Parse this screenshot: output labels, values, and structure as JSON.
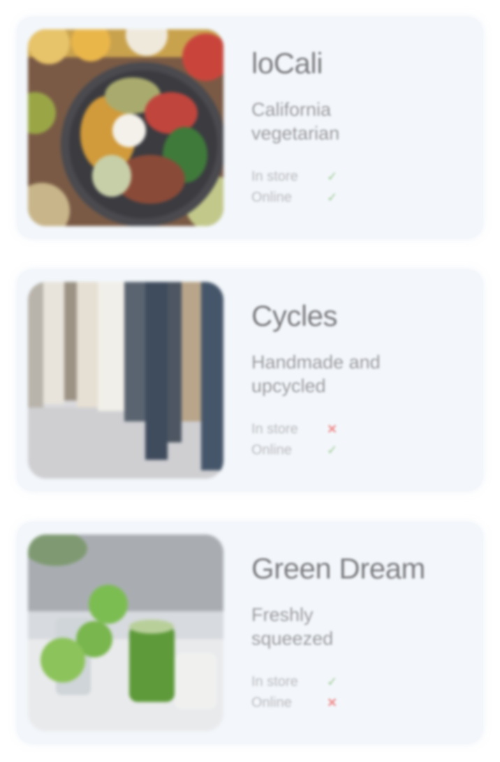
{
  "colors": {
    "card_bg": "#f3f7fb",
    "title": "#7c7c80",
    "subtitle": "#9b9b9f",
    "available": "#b6d6b2",
    "unavailable": "#ef8a8a"
  },
  "shops": [
    {
      "name": "loCali",
      "tagline": "California vegetarian",
      "image_icon": "food-bowl-photo",
      "availability": [
        {
          "label": "In store",
          "mark": "✓",
          "available": true
        },
        {
          "label": "Online",
          "mark": "✓",
          "available": true
        }
      ]
    },
    {
      "name": "Cycles",
      "tagline": "Handmade and upcycled",
      "image_icon": "clothing-rack-photo",
      "availability": [
        {
          "label": "In store",
          "mark": "✕",
          "available": false
        },
        {
          "label": "Online",
          "mark": "✓",
          "available": true
        }
      ]
    },
    {
      "name": "Green Dream",
      "tagline": "Freshly squeezed",
      "image_icon": "green-juice-photo",
      "availability": [
        {
          "label": "In store",
          "mark": "✓",
          "available": true
        },
        {
          "label": "Online",
          "mark": "✕",
          "available": false
        }
      ]
    }
  ]
}
